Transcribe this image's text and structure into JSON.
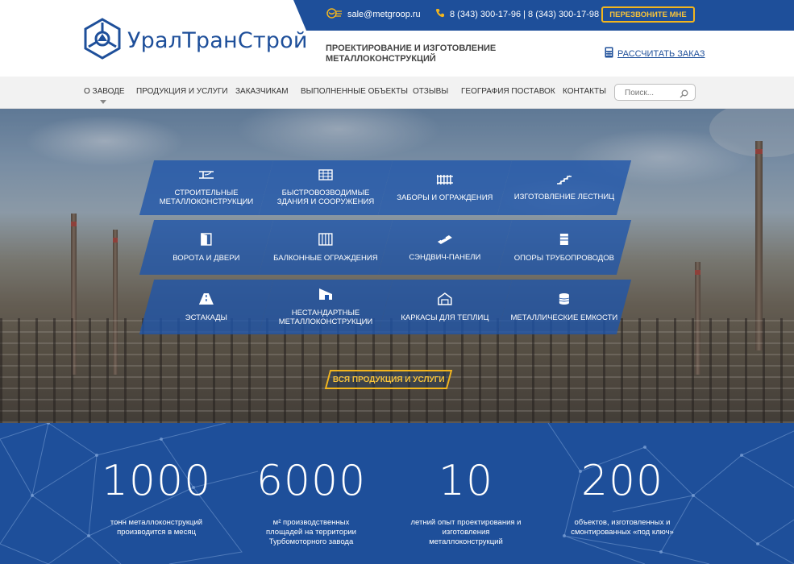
{
  "header": {
    "email": "sale@metgroop.ru",
    "phones": "8 (343) 300-17-96 | 8 (343) 300-17-98",
    "callback_label": "ПЕРЕЗВОНИТЕ МНЕ",
    "logo_text": "УралТранСтрой",
    "tagline": "ПРОЕКТИРОВАНИЕ И ИЗГОТОВЛЕНИЕ МЕТАЛЛОКОНСТРУКЦИЙ",
    "calc_label": "РАССЧИТАТЬ ЗАКАЗ",
    "brand_color": "#1e4f9a",
    "accent_color": "#f2b51e"
  },
  "nav": {
    "items": [
      {
        "label": "О ЗАВОДЕ"
      },
      {
        "label": "ПРОДУКЦИЯ И УСЛУГИ"
      },
      {
        "label": "ЗАКАЗЧИКАМ"
      },
      {
        "label": "ВЫПОЛНЕННЫЕ ОБЪЕКТЫ"
      },
      {
        "label": "ОТЗЫВЫ"
      },
      {
        "label": "ГЕОГРАФИЯ ПОСТАВОК"
      },
      {
        "label": "КОНТАКТЫ"
      }
    ],
    "search_placeholder": "Поиск..."
  },
  "products": [
    {
      "label": "СТРОИТЕЛЬНЫЕ МЕТАЛЛОКОНСТРУКЦИИ",
      "icon": "beam-icon"
    },
    {
      "label": "БЫСТРОВОЗВОДИМЫЕ ЗДАНИЯ И СООРУЖЕНИЯ",
      "icon": "building-icon"
    },
    {
      "label": "ЗАБОРЫ И ОГРАЖДЕНИЯ",
      "icon": "fence-icon"
    },
    {
      "label": "ИЗГОТОВЛЕНИЕ ЛЕСТНИЦ",
      "icon": "stairs-icon"
    },
    {
      "label": "ВОРОТА И ДВЕРИ",
      "icon": "door-icon"
    },
    {
      "label": "БАЛКОННЫЕ ОГРАЖДЕНИЯ",
      "icon": "balcony-icon"
    },
    {
      "label": "СЭНДВИЧ-ПАНЕЛИ",
      "icon": "panel-icon"
    },
    {
      "label": "ОПОРЫ ТРУБОПРОВОДОВ",
      "icon": "pipe-support-icon"
    },
    {
      "label": "ЭСТАКАДЫ",
      "icon": "overpass-icon"
    },
    {
      "label": "НЕСТАНДАРТНЫЕ МЕТАЛЛОКОНСТРУКЦИИ",
      "icon": "custom-structure-icon"
    },
    {
      "label": "КАРКАСЫ ДЛЯ ТЕПЛИЦ",
      "icon": "greenhouse-icon"
    },
    {
      "label": "МЕТАЛЛИЧЕСКИЕ ЕМКОСТИ",
      "icon": "tank-icon"
    }
  ],
  "all_products_label": "ВСЯ ПРОДУКЦИЯ И УСЛУГИ",
  "stats": [
    {
      "number": "1000",
      "caption": "тонн металлоконструкций производится в месяц"
    },
    {
      "number": "6000",
      "caption": "м² производственных площадей на территории Турбомоторного завода"
    },
    {
      "number": "10",
      "caption": "летний опыт проектирования и изготовления металлоконструкций"
    },
    {
      "number": "200",
      "caption": "объектов, изготовленных и смонтированных «под ключ»"
    }
  ]
}
